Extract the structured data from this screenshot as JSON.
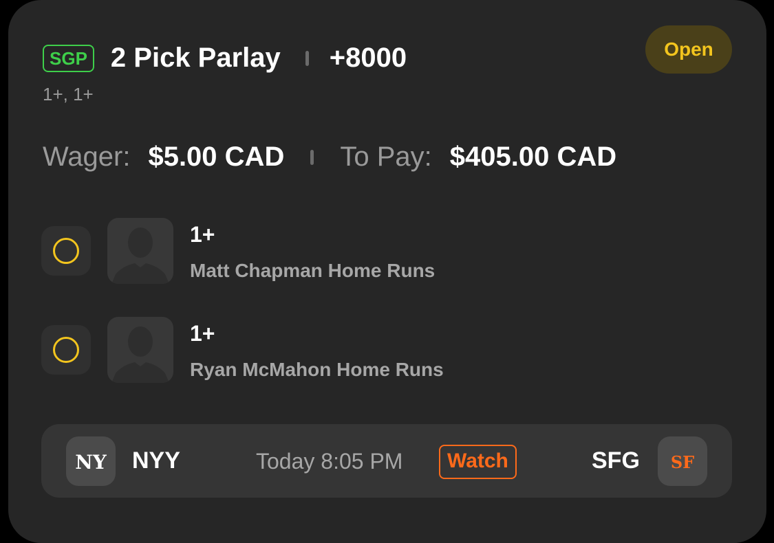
{
  "bet": {
    "badge": "SGP",
    "title": "2 Pick Parlay",
    "odds": "+8000",
    "subtitle": "1+, 1+",
    "status": "Open",
    "wager_label": "Wager:",
    "wager_value": "$5.00 CAD",
    "topay_label": "To Pay:",
    "topay_value": "$405.00 CAD"
  },
  "legs": [
    {
      "line": "1+",
      "market": "Matt Chapman Home Runs"
    },
    {
      "line": "1+",
      "market": "Ryan McMahon Home Runs"
    }
  ],
  "game": {
    "away_team": "NYY",
    "home_team": "SFG",
    "time": "Today 8:05 PM",
    "watch_label": "Watch",
    "away_logo": "NY",
    "home_logo": "SF"
  },
  "colors": {
    "sgp_green": "#3ecf4a",
    "status_yellow": "#f3c51e",
    "watch_orange": "#ff6a1a",
    "card_bg": "#262626"
  },
  "icons": {
    "leg_status": "pending-circle-icon",
    "player": "player-silhouette-icon",
    "away_logo": "yankees-logo-icon",
    "home_logo": "giants-logo-icon"
  }
}
